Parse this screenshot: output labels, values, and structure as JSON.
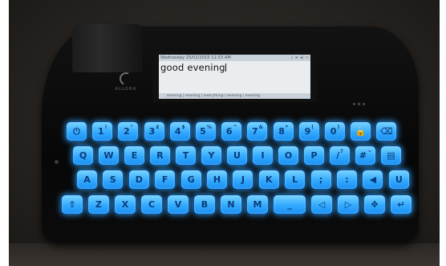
{
  "screen": {
    "status_text": "Wednesday 25/02/2015 11:53 AM",
    "status_icons": [
      "bluetooth-icon",
      "wifi-icon",
      "volume-icon",
      "battery-icon"
    ],
    "typed_text": "good evening",
    "prediction_text": "evening | evening | everything | evening | evening"
  },
  "logo": {
    "text": "ALLORA"
  },
  "keyboard": {
    "backlight_color": "#32a9ff",
    "rows": [
      [
        {
          "label": "⏻",
          "icon": "power-icon"
        },
        {
          "label": "1",
          "sup": "!"
        },
        {
          "label": "2",
          "sup": "\""
        },
        {
          "label": "3",
          "sup": "£"
        },
        {
          "label": "4",
          "sup": "$"
        },
        {
          "label": "5",
          "sup": "%"
        },
        {
          "label": "6",
          "sup": "^"
        },
        {
          "label": "7",
          "sup": "&"
        },
        {
          "label": "8",
          "sup": "*"
        },
        {
          "label": "9",
          "sup": "("
        },
        {
          "label": "0",
          "sup": ")"
        },
        {
          "label": "🔒",
          "icon": "lock-icon"
        },
        {
          "label": "⌫",
          "icon": "backspace-icon"
        }
      ],
      [
        {
          "label": "Q"
        },
        {
          "label": "W"
        },
        {
          "label": "E"
        },
        {
          "label": "R"
        },
        {
          "label": "T"
        },
        {
          "label": "Y"
        },
        {
          "label": "U"
        },
        {
          "label": "I"
        },
        {
          "label": "O"
        },
        {
          "label": "P"
        },
        {
          "label": "/",
          "sup": "?"
        },
        {
          "label": "#",
          "sup": "~"
        },
        {
          "label": "▤",
          "icon": "menu-icon"
        }
      ],
      [
        {
          "label": "A"
        },
        {
          "label": "S"
        },
        {
          "label": "D"
        },
        {
          "label": "F"
        },
        {
          "label": "G"
        },
        {
          "label": "H"
        },
        {
          "label": "J"
        },
        {
          "label": "K"
        },
        {
          "label": "L"
        },
        {
          "label": ";"
        },
        {
          "label": ":"
        },
        {
          "label": "◀",
          "icon": "speak-icon"
        },
        {
          "label": "U",
          "icon": "undo-icon"
        }
      ],
      [
        {
          "label": "⇧",
          "icon": "shift-icon"
        },
        {
          "label": "Z"
        },
        {
          "label": "X"
        },
        {
          "label": "C"
        },
        {
          "label": "V"
        },
        {
          "label": "B"
        },
        {
          "label": "N"
        },
        {
          "label": "M"
        },
        {
          "label": "_",
          "icon": "space-icon",
          "wide": true
        },
        {
          "label": "◁",
          "icon": "arrow-left-icon"
        },
        {
          "label": "▷",
          "icon": "arrow-right-icon"
        },
        {
          "label": "✥",
          "icon": "settings-icon"
        },
        {
          "label": "↵",
          "icon": "enter-icon"
        }
      ]
    ]
  }
}
